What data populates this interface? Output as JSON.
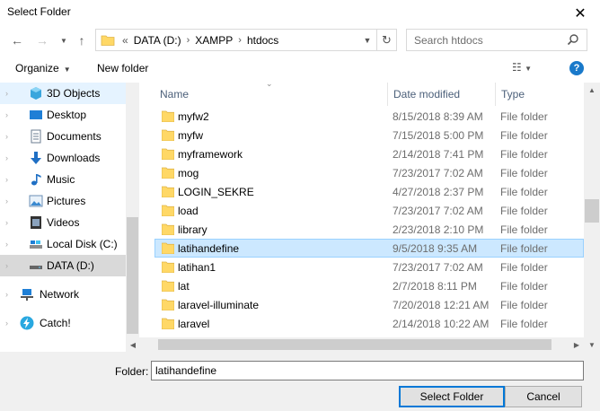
{
  "window": {
    "title": "Select Folder"
  },
  "address": {
    "overflow": "«",
    "crumbs": [
      "DATA (D:)",
      "XAMPP",
      "htdocs"
    ],
    "separator": "›"
  },
  "search": {
    "placeholder": "Search htdocs"
  },
  "toolbar": {
    "organize_label": "Organize",
    "new_folder_label": "New folder"
  },
  "nav": {
    "items": [
      {
        "label": "3D Objects",
        "icon": "3d-objects-icon"
      },
      {
        "label": "Desktop",
        "icon": "desktop-icon"
      },
      {
        "label": "Documents",
        "icon": "documents-icon"
      },
      {
        "label": "Downloads",
        "icon": "downloads-icon"
      },
      {
        "label": "Music",
        "icon": "music-icon"
      },
      {
        "label": "Pictures",
        "icon": "pictures-icon"
      },
      {
        "label": "Videos",
        "icon": "videos-icon"
      },
      {
        "label": "Local Disk (C:)",
        "icon": "drive-icon"
      },
      {
        "label": "DATA (D:)",
        "icon": "drive-icon"
      },
      {
        "label": "Network",
        "icon": "network-icon"
      },
      {
        "label": "Catch!",
        "icon": "lightning-icon"
      }
    ]
  },
  "columns": {
    "name": "Name",
    "date": "Date modified",
    "type": "Type"
  },
  "files": [
    {
      "name": "myfw2",
      "date": "8/15/2018 8:39 AM",
      "type": "File folder"
    },
    {
      "name": "myfw",
      "date": "7/15/2018 5:00 PM",
      "type": "File folder"
    },
    {
      "name": "myframework",
      "date": "2/14/2018 7:41 PM",
      "type": "File folder"
    },
    {
      "name": "mog",
      "date": "7/23/2017 7:02 AM",
      "type": "File folder"
    },
    {
      "name": "LOGIN_SEKRE",
      "date": "4/27/2018 2:37 PM",
      "type": "File folder"
    },
    {
      "name": "load",
      "date": "7/23/2017 7:02 AM",
      "type": "File folder"
    },
    {
      "name": "library",
      "date": "2/23/2018 2:10 PM",
      "type": "File folder"
    },
    {
      "name": "latihandefine",
      "date": "9/5/2018 9:35 AM",
      "type": "File folder"
    },
    {
      "name": "latihan1",
      "date": "7/23/2017 7:02 AM",
      "type": "File folder"
    },
    {
      "name": "lat",
      "date": "2/7/2018 8:11 PM",
      "type": "File folder"
    },
    {
      "name": "laravel-illuminate",
      "date": "7/20/2018 12:21 AM",
      "type": "File folder"
    },
    {
      "name": "laravel",
      "date": "2/14/2018 10:22 AM",
      "type": "File folder"
    }
  ],
  "footer": {
    "folder_label": "Folder:",
    "folder_value": "latihandefine",
    "select_label": "Select Folder",
    "cancel_label": "Cancel"
  },
  "colors": {
    "accent": "#0078d7",
    "selection": "#cce8ff",
    "folder": "#ffd866",
    "help": "#1979ca"
  }
}
